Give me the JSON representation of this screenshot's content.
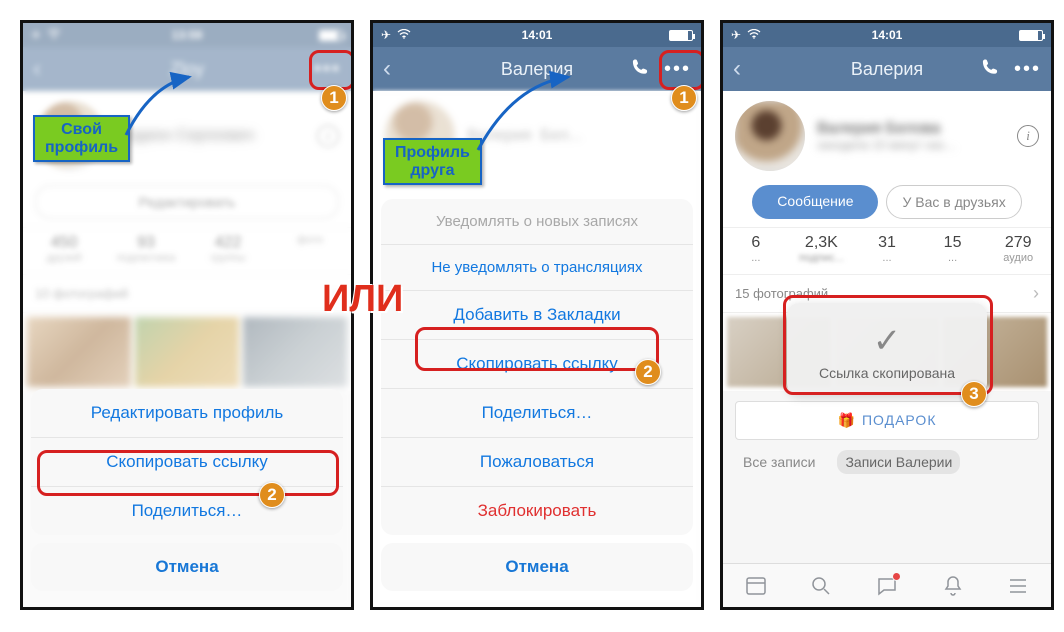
{
  "status_time": [
    "13:59",
    "14:01",
    "14:01"
  ],
  "phone1": {
    "nav_title": "Zloy",
    "profile_name": "Родион Сергеевич",
    "edit_btn": "Редактировать",
    "stats": [
      {
        "num": "450",
        "lbl": "друзей"
      },
      {
        "num": "93",
        "lbl": "подписчика"
      },
      {
        "num": "422",
        "lbl": "группы"
      },
      {
        "num": "",
        "lbl": "фото"
      }
    ],
    "photos_hdr": "10 фотографий",
    "sheet": {
      "items": [
        "Редактировать профиль",
        "Скопировать ссылку",
        "Поделиться…"
      ],
      "cancel": "Отмена"
    }
  },
  "phone2": {
    "nav_title": "Валерия",
    "sheet": {
      "items": [
        "Уведомлять о новых записях",
        "Не уведомлять о трансляциях",
        "Добавить в Закладки",
        "Скопировать ссылку",
        "Поделиться…",
        "Пожаловаться",
        "Заблокировать"
      ],
      "cancel": "Отмена"
    }
  },
  "phone3": {
    "nav_title": "Валерия",
    "profile_name": "Валерия Белова",
    "profile_sub": "заходила 10 минут наз…",
    "btn_msg": "Сообщение",
    "btn_friend": "У Вас в друзьях",
    "stats": [
      {
        "num": "6",
        "lbl": "..."
      },
      {
        "num": "2,3K",
        "lbl": "подпис..."
      },
      {
        "num": "31",
        "lbl": "..."
      },
      {
        "num": "15",
        "lbl": "..."
      },
      {
        "num": "279",
        "lbl": "аудио"
      }
    ],
    "photos_hdr": "15 фотографий",
    "toast": "Ссылка скопирована",
    "gift_btn": "ПОДАРОК",
    "tabs": [
      "Все записи",
      "Записи Валерии"
    ]
  },
  "annotations": {
    "own_profile_label": "Свой\nпрофиль",
    "friend_profile_label": "Профиль\nдруга",
    "or_text": "ИЛИ",
    "step1": "1",
    "step2": "2",
    "step3": "3"
  }
}
